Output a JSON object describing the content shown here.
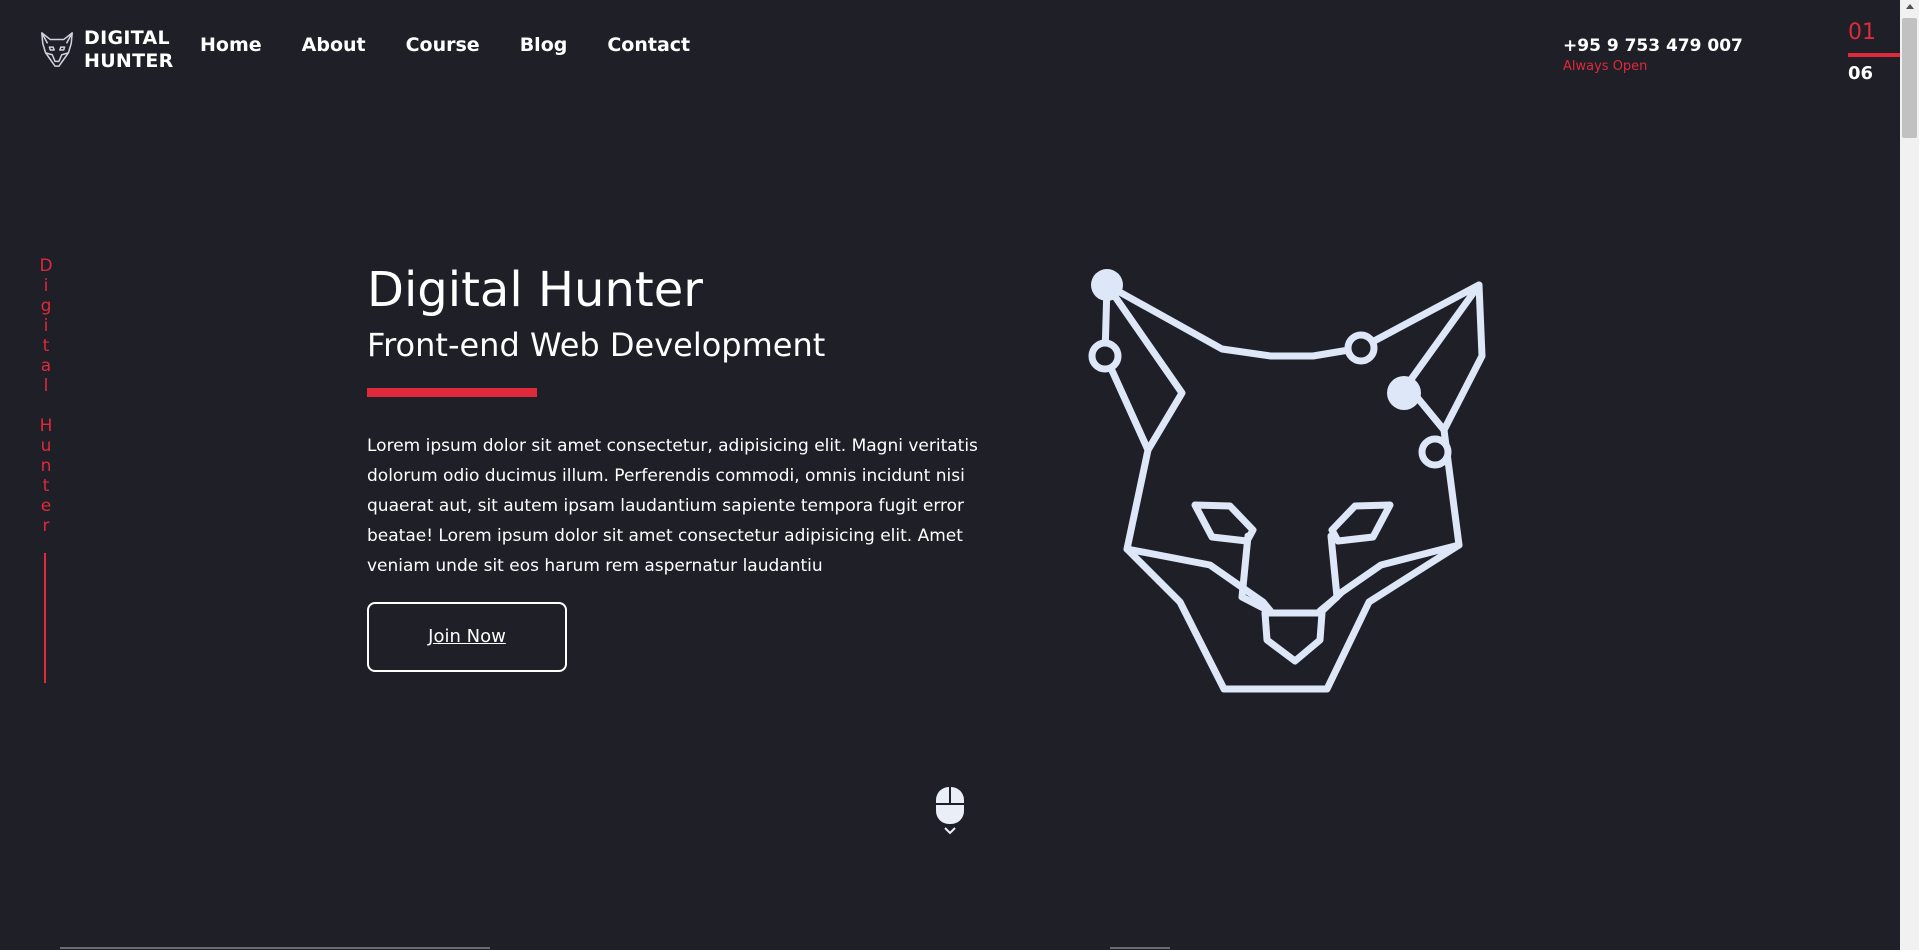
{
  "brand": {
    "line1": "DIGITAL",
    "line2": "HUNTER",
    "logo_icon": "fox-head-icon"
  },
  "nav": {
    "items": [
      {
        "label": "Home"
      },
      {
        "label": "About"
      },
      {
        "label": "Course"
      },
      {
        "label": "Blog"
      },
      {
        "label": "Contact"
      }
    ]
  },
  "contact": {
    "phone": "+95 9 753 479 007",
    "hours": "Always Open"
  },
  "slider": {
    "current": "01",
    "total": "06"
  },
  "side_label": {
    "word1": [
      "D",
      "i",
      "g",
      "i",
      "t",
      "a",
      "l"
    ],
    "word2": [
      "H",
      "u",
      "n",
      "t",
      "e",
      "r"
    ]
  },
  "hero": {
    "title": "Digital Hunter",
    "subtitle": "Front-end Web Development",
    "text": "Lorem ipsum dolor sit amet consectetur, adipisicing elit. Magni veritatis dolorum odio ducimus illum. Perferendis commodi, omnis incidunt nisi quaerat aut, sit autem ipsam laudantium sapiente tempora fugit error beatae! Lorem ipsum dolor sit amet consectetur adipisicing elit. Amet veniam unde sit eos harum rem aspernatur laudantiu",
    "button_label": "Join Now",
    "illustration_icon": "fox-head-line-art-icon"
  },
  "scroll_indicator": {
    "icon": "mouse-scroll-icon"
  },
  "colors": {
    "background": "#1f1f28",
    "accent": "#e0293a",
    "text": "#ffffff",
    "illustration": "#dde7f7"
  }
}
